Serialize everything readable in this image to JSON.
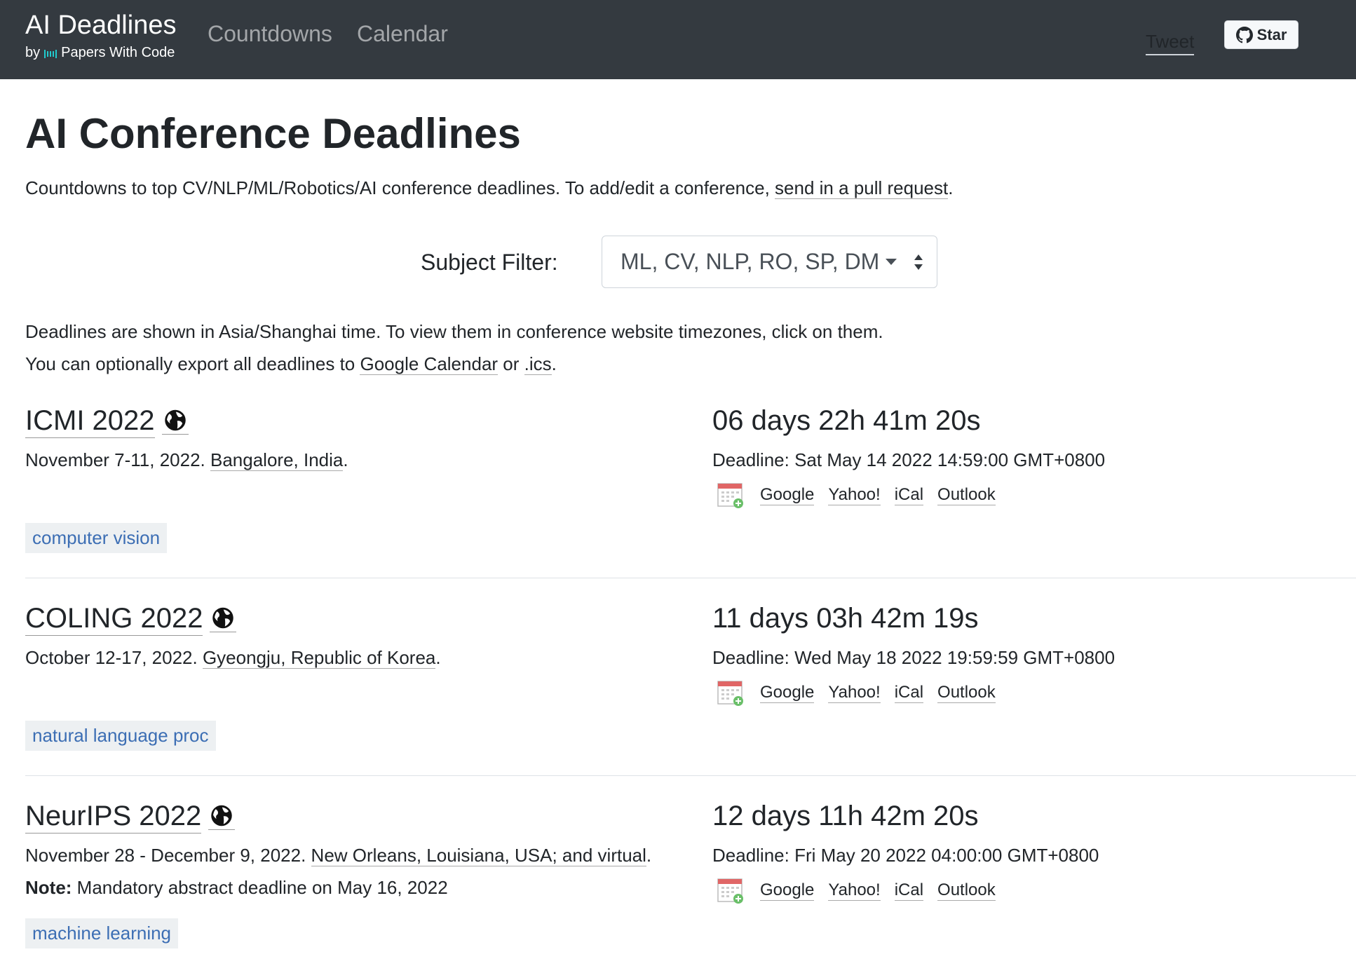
{
  "navbar": {
    "brand_title": "AI Deadlines",
    "brand_by": "by",
    "brand_sub": "Papers With Code",
    "nav_countdowns": "Countdowns",
    "nav_calendar": "Calendar",
    "tweet": "Tweet",
    "star": "Star"
  },
  "header": {
    "title": "AI Conference Deadlines",
    "intro_prefix": "Countdowns to top CV/NLP/ML/Robotics/AI conference deadlines. To add/edit a conference, ",
    "intro_link": "send in a pull request",
    "intro_suffix": "."
  },
  "filter": {
    "label": "Subject Filter:",
    "selected": "ML, CV, NLP, RO, SP, DM"
  },
  "tz_note": {
    "line1": "Deadlines are shown in Asia/Shanghai time. To view them in conference website timezones, click on them.",
    "line2_prefix": "You can optionally export all deadlines to ",
    "google_calendar": "Google Calendar",
    "or": " or ",
    "ics": ".ics",
    "end": "."
  },
  "calendar_links": {
    "google": "Google",
    "yahoo": "Yahoo!",
    "ical": "iCal",
    "outlook": "Outlook"
  },
  "conferences": [
    {
      "title": "ICMI 2022",
      "dates": "November 7-11, 2022. ",
      "location": "Bangalore, India",
      "note_label": "",
      "note": "",
      "tag": "computer vision",
      "countdown": "06 days 22h 41m 20s",
      "deadline": "Deadline: Sat May 14 2022 14:59:00 GMT+0800"
    },
    {
      "title": "COLING 2022",
      "dates": "October 12-17, 2022. ",
      "location": "Gyeongju, Republic of Korea",
      "note_label": "",
      "note": "",
      "tag": "natural language proc",
      "countdown": "11 days 03h 42m 19s",
      "deadline": "Deadline: Wed May 18 2022 19:59:59 GMT+0800"
    },
    {
      "title": "NeurIPS 2022",
      "dates": "November 28 - December 9, 2022. ",
      "location": "New Orleans, Louisiana, USA; and virtual",
      "note_label": "Note:",
      "note": " Mandatory abstract deadline on May 16, 2022",
      "tag": "machine learning",
      "countdown": "12 days 11h 42m 20s",
      "deadline": "Deadline: Fri May 20 2022 04:00:00 GMT+0800"
    }
  ]
}
